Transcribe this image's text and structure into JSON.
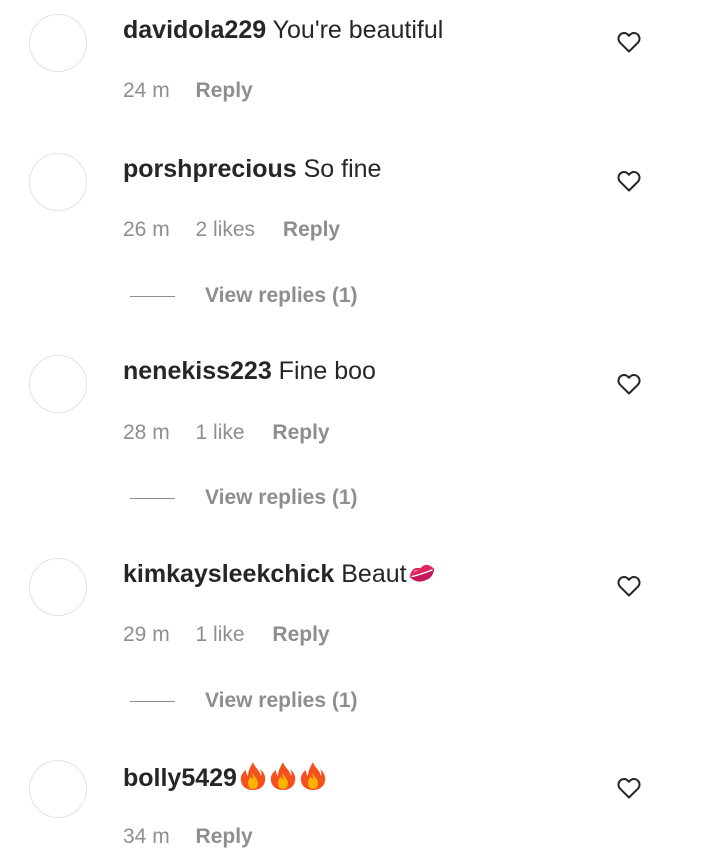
{
  "comments": [
    {
      "username": "davidola229",
      "text": "You're beautiful",
      "time": "24 m",
      "likes": "",
      "reply_label": "Reply",
      "view_replies": ""
    },
    {
      "username": "porshprecious",
      "text": "So fine",
      "time": "26 m",
      "likes": "2 likes",
      "reply_label": "Reply",
      "view_replies": "View replies (1)"
    },
    {
      "username": "nenekiss223",
      "text": "Fine boo",
      "time": "28 m",
      "likes": "1 like",
      "reply_label": "Reply",
      "view_replies": "View replies (1)"
    },
    {
      "username": "kimkaysleekchick",
      "text": "Beaut",
      "emoji": "kiss-mark-icon",
      "time": "29 m",
      "likes": "1 like",
      "reply_label": "Reply",
      "view_replies": "View replies (1)"
    },
    {
      "username": "bolly5429",
      "text": "",
      "emoji": "fire-icon x3",
      "time": "34 m",
      "likes": "",
      "reply_label": "Reply",
      "view_replies": ""
    }
  ],
  "icons": {
    "like": "heart-outline-icon"
  },
  "colors": {
    "primary_text": "#262626",
    "secondary_text": "#8e8e8e",
    "avatar_border": "#e3e3e3"
  }
}
